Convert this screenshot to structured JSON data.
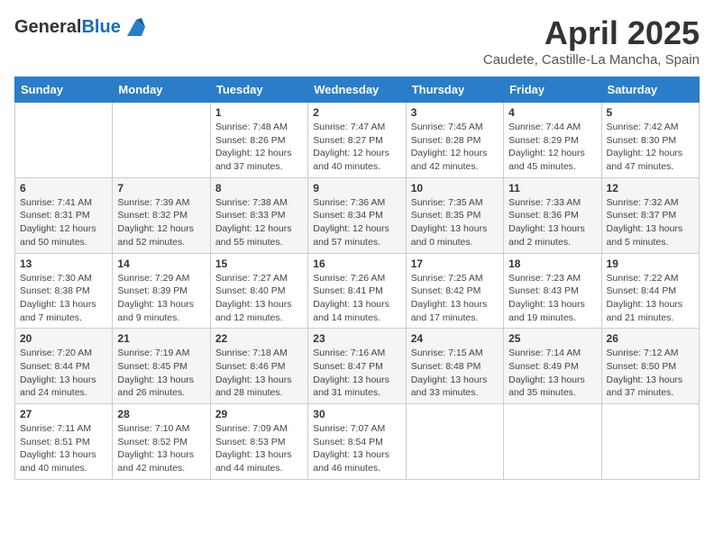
{
  "header": {
    "logo_general": "General",
    "logo_blue": "Blue",
    "title": "April 2025",
    "subtitle": "Caudete, Castille-La Mancha, Spain"
  },
  "weekdays": [
    "Sunday",
    "Monday",
    "Tuesday",
    "Wednesday",
    "Thursday",
    "Friday",
    "Saturday"
  ],
  "rows": [
    [
      {
        "day": "",
        "sunrise": "",
        "sunset": "",
        "daylight": ""
      },
      {
        "day": "",
        "sunrise": "",
        "sunset": "",
        "daylight": ""
      },
      {
        "day": "1",
        "sunrise": "Sunrise: 7:48 AM",
        "sunset": "Sunset: 8:26 PM",
        "daylight": "Daylight: 12 hours and 37 minutes."
      },
      {
        "day": "2",
        "sunrise": "Sunrise: 7:47 AM",
        "sunset": "Sunset: 8:27 PM",
        "daylight": "Daylight: 12 hours and 40 minutes."
      },
      {
        "day": "3",
        "sunrise": "Sunrise: 7:45 AM",
        "sunset": "Sunset: 8:28 PM",
        "daylight": "Daylight: 12 hours and 42 minutes."
      },
      {
        "day": "4",
        "sunrise": "Sunrise: 7:44 AM",
        "sunset": "Sunset: 8:29 PM",
        "daylight": "Daylight: 12 hours and 45 minutes."
      },
      {
        "day": "5",
        "sunrise": "Sunrise: 7:42 AM",
        "sunset": "Sunset: 8:30 PM",
        "daylight": "Daylight: 12 hours and 47 minutes."
      }
    ],
    [
      {
        "day": "6",
        "sunrise": "Sunrise: 7:41 AM",
        "sunset": "Sunset: 8:31 PM",
        "daylight": "Daylight: 12 hours and 50 minutes."
      },
      {
        "day": "7",
        "sunrise": "Sunrise: 7:39 AM",
        "sunset": "Sunset: 8:32 PM",
        "daylight": "Daylight: 12 hours and 52 minutes."
      },
      {
        "day": "8",
        "sunrise": "Sunrise: 7:38 AM",
        "sunset": "Sunset: 8:33 PM",
        "daylight": "Daylight: 12 hours and 55 minutes."
      },
      {
        "day": "9",
        "sunrise": "Sunrise: 7:36 AM",
        "sunset": "Sunset: 8:34 PM",
        "daylight": "Daylight: 12 hours and 57 minutes."
      },
      {
        "day": "10",
        "sunrise": "Sunrise: 7:35 AM",
        "sunset": "Sunset: 8:35 PM",
        "daylight": "Daylight: 13 hours and 0 minutes."
      },
      {
        "day": "11",
        "sunrise": "Sunrise: 7:33 AM",
        "sunset": "Sunset: 8:36 PM",
        "daylight": "Daylight: 13 hours and 2 minutes."
      },
      {
        "day": "12",
        "sunrise": "Sunrise: 7:32 AM",
        "sunset": "Sunset: 8:37 PM",
        "daylight": "Daylight: 13 hours and 5 minutes."
      }
    ],
    [
      {
        "day": "13",
        "sunrise": "Sunrise: 7:30 AM",
        "sunset": "Sunset: 8:38 PM",
        "daylight": "Daylight: 13 hours and 7 minutes."
      },
      {
        "day": "14",
        "sunrise": "Sunrise: 7:29 AM",
        "sunset": "Sunset: 8:39 PM",
        "daylight": "Daylight: 13 hours and 9 minutes."
      },
      {
        "day": "15",
        "sunrise": "Sunrise: 7:27 AM",
        "sunset": "Sunset: 8:40 PM",
        "daylight": "Daylight: 13 hours and 12 minutes."
      },
      {
        "day": "16",
        "sunrise": "Sunrise: 7:26 AM",
        "sunset": "Sunset: 8:41 PM",
        "daylight": "Daylight: 13 hours and 14 minutes."
      },
      {
        "day": "17",
        "sunrise": "Sunrise: 7:25 AM",
        "sunset": "Sunset: 8:42 PM",
        "daylight": "Daylight: 13 hours and 17 minutes."
      },
      {
        "day": "18",
        "sunrise": "Sunrise: 7:23 AM",
        "sunset": "Sunset: 8:43 PM",
        "daylight": "Daylight: 13 hours and 19 minutes."
      },
      {
        "day": "19",
        "sunrise": "Sunrise: 7:22 AM",
        "sunset": "Sunset: 8:44 PM",
        "daylight": "Daylight: 13 hours and 21 minutes."
      }
    ],
    [
      {
        "day": "20",
        "sunrise": "Sunrise: 7:20 AM",
        "sunset": "Sunset: 8:44 PM",
        "daylight": "Daylight: 13 hours and 24 minutes."
      },
      {
        "day": "21",
        "sunrise": "Sunrise: 7:19 AM",
        "sunset": "Sunset: 8:45 PM",
        "daylight": "Daylight: 13 hours and 26 minutes."
      },
      {
        "day": "22",
        "sunrise": "Sunrise: 7:18 AM",
        "sunset": "Sunset: 8:46 PM",
        "daylight": "Daylight: 13 hours and 28 minutes."
      },
      {
        "day": "23",
        "sunrise": "Sunrise: 7:16 AM",
        "sunset": "Sunset: 8:47 PM",
        "daylight": "Daylight: 13 hours and 31 minutes."
      },
      {
        "day": "24",
        "sunrise": "Sunrise: 7:15 AM",
        "sunset": "Sunset: 8:48 PM",
        "daylight": "Daylight: 13 hours and 33 minutes."
      },
      {
        "day": "25",
        "sunrise": "Sunrise: 7:14 AM",
        "sunset": "Sunset: 8:49 PM",
        "daylight": "Daylight: 13 hours and 35 minutes."
      },
      {
        "day": "26",
        "sunrise": "Sunrise: 7:12 AM",
        "sunset": "Sunset: 8:50 PM",
        "daylight": "Daylight: 13 hours and 37 minutes."
      }
    ],
    [
      {
        "day": "27",
        "sunrise": "Sunrise: 7:11 AM",
        "sunset": "Sunset: 8:51 PM",
        "daylight": "Daylight: 13 hours and 40 minutes."
      },
      {
        "day": "28",
        "sunrise": "Sunrise: 7:10 AM",
        "sunset": "Sunset: 8:52 PM",
        "daylight": "Daylight: 13 hours and 42 minutes."
      },
      {
        "day": "29",
        "sunrise": "Sunrise: 7:09 AM",
        "sunset": "Sunset: 8:53 PM",
        "daylight": "Daylight: 13 hours and 44 minutes."
      },
      {
        "day": "30",
        "sunrise": "Sunrise: 7:07 AM",
        "sunset": "Sunset: 8:54 PM",
        "daylight": "Daylight: 13 hours and 46 minutes."
      },
      {
        "day": "",
        "sunrise": "",
        "sunset": "",
        "daylight": ""
      },
      {
        "day": "",
        "sunrise": "",
        "sunset": "",
        "daylight": ""
      },
      {
        "day": "",
        "sunrise": "",
        "sunset": "",
        "daylight": ""
      }
    ]
  ]
}
